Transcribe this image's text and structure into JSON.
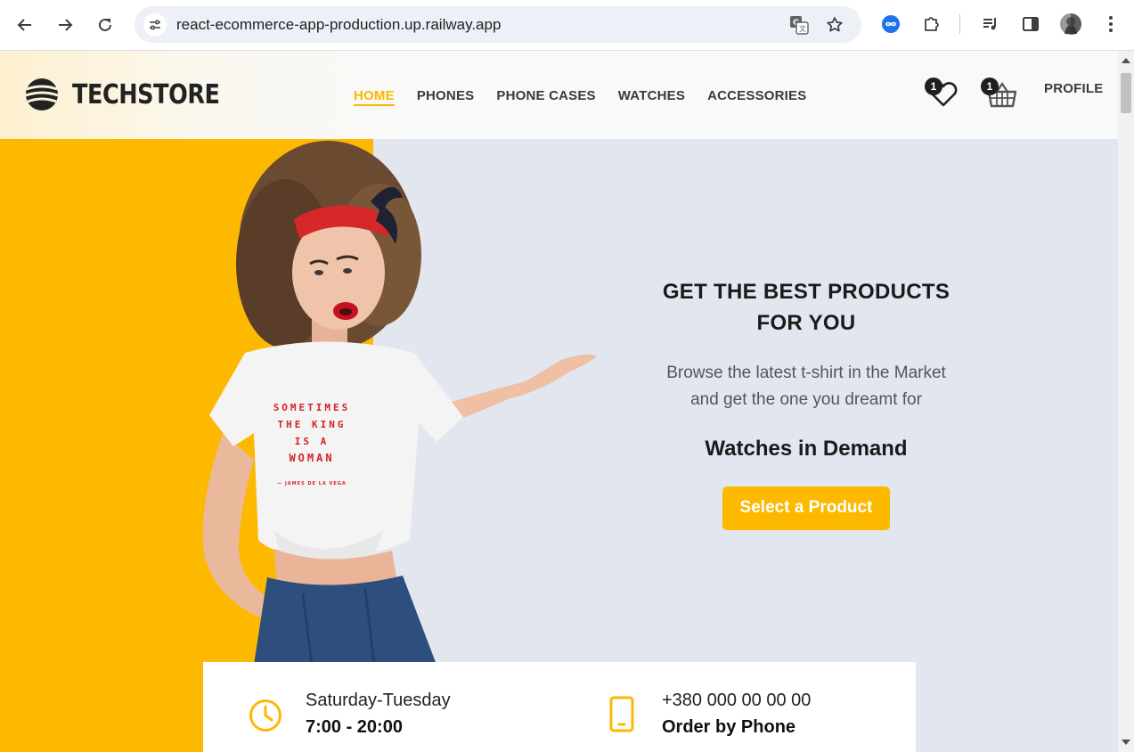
{
  "browser": {
    "url": "react-ecommerce-app-production.up.railway.app"
  },
  "site": {
    "logo_text": "TECHSTORE",
    "nav": [
      {
        "label": "HOME",
        "active": true
      },
      {
        "label": "PHONES",
        "active": false
      },
      {
        "label": "PHONE CASES",
        "active": false
      },
      {
        "label": "WATCHES",
        "active": false
      },
      {
        "label": "ACCESSORIES",
        "active": false
      }
    ],
    "wishlist_count": "1",
    "cart_count": "1",
    "profile_label": "PROFILE"
  },
  "hero": {
    "title_line1": "GET THE BEST PRODUCTS",
    "title_line2": "FOR YOU",
    "subtitle": "Browse the latest t-shirt in the Market and get the one you dreamt for",
    "demand": "Watches in Demand",
    "cta": "Select a Product",
    "shirt_print": [
      "SOMETIMES",
      "THE KING",
      "IS A",
      "WOMAN",
      "— JAMES DE LA VEGA"
    ]
  },
  "info": {
    "hours_days": "Saturday-Tuesday",
    "hours_time": "7:00 - 20:00",
    "phone_number": "+380 000 00 00 00",
    "phone_label": "Order by Phone"
  },
  "colors": {
    "accent": "#fcb900",
    "hero_bg": "#e2e7ef",
    "text_dark": "#1a1a1a"
  },
  "icons": [
    "back-arrow-icon",
    "forward-arrow-icon",
    "reload-icon",
    "site-settings-icon",
    "translate-icon",
    "bookmark-star-icon",
    "extension-infinity-icon",
    "extensions-puzzle-icon",
    "media-queue-icon",
    "side-panel-icon",
    "profile-avatar-icon",
    "kebab-menu-icon",
    "heart-icon",
    "basket-icon",
    "clock-icon",
    "phone-icon"
  ]
}
